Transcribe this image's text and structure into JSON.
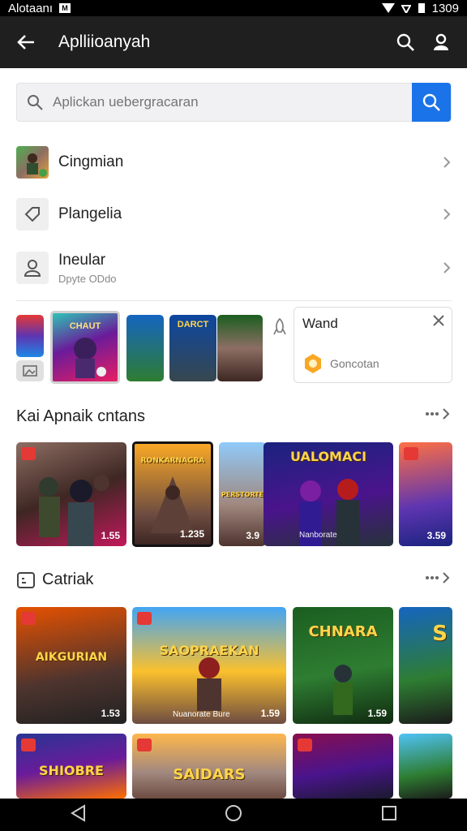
{
  "status": {
    "left_text": "Alotaanı",
    "time": "1309"
  },
  "appbar": {
    "title": "Aplliioanyah"
  },
  "search": {
    "placeholder": "Aplickan uebergracaran"
  },
  "rows": [
    {
      "label": "Cingmian"
    },
    {
      "label": "Plangelia"
    },
    {
      "label": "Ineular",
      "sub": "Dpyte ODdo"
    }
  ],
  "featured_thumbs": [
    {
      "label": "CHAUT"
    },
    {
      "label": "DARCT"
    }
  ],
  "card": {
    "title": "Wand",
    "sub": "Goncotan"
  },
  "section1": {
    "title": "Kai Apnaik cntans",
    "tiles": [
      {
        "num": "1.55"
      },
      {
        "title": "RONKARNAGRA",
        "num": "1.235"
      },
      {
        "title": "PERSTORTE",
        "num": "3.9"
      },
      {
        "title": "UALOMACI",
        "caption": "Nanborate",
        "num": ""
      },
      {
        "num": "3.59"
      }
    ]
  },
  "section2": {
    "title": "Catriak",
    "tiles": [
      {
        "title": "AIKGURIAN",
        "num": "1.53"
      },
      {
        "title": "SAOPRAEKAN",
        "caption": "Nuanorate Bure",
        "num": "1.59"
      },
      {
        "title": "CHNARA",
        "num": "1.59"
      },
      {
        "title": "S"
      }
    ]
  },
  "section3": {
    "tiles": [
      {
        "title": "SHIOBRE"
      },
      {
        "title": "SAIDARS"
      },
      {
        "title": ""
      },
      {
        "title": ""
      }
    ]
  }
}
